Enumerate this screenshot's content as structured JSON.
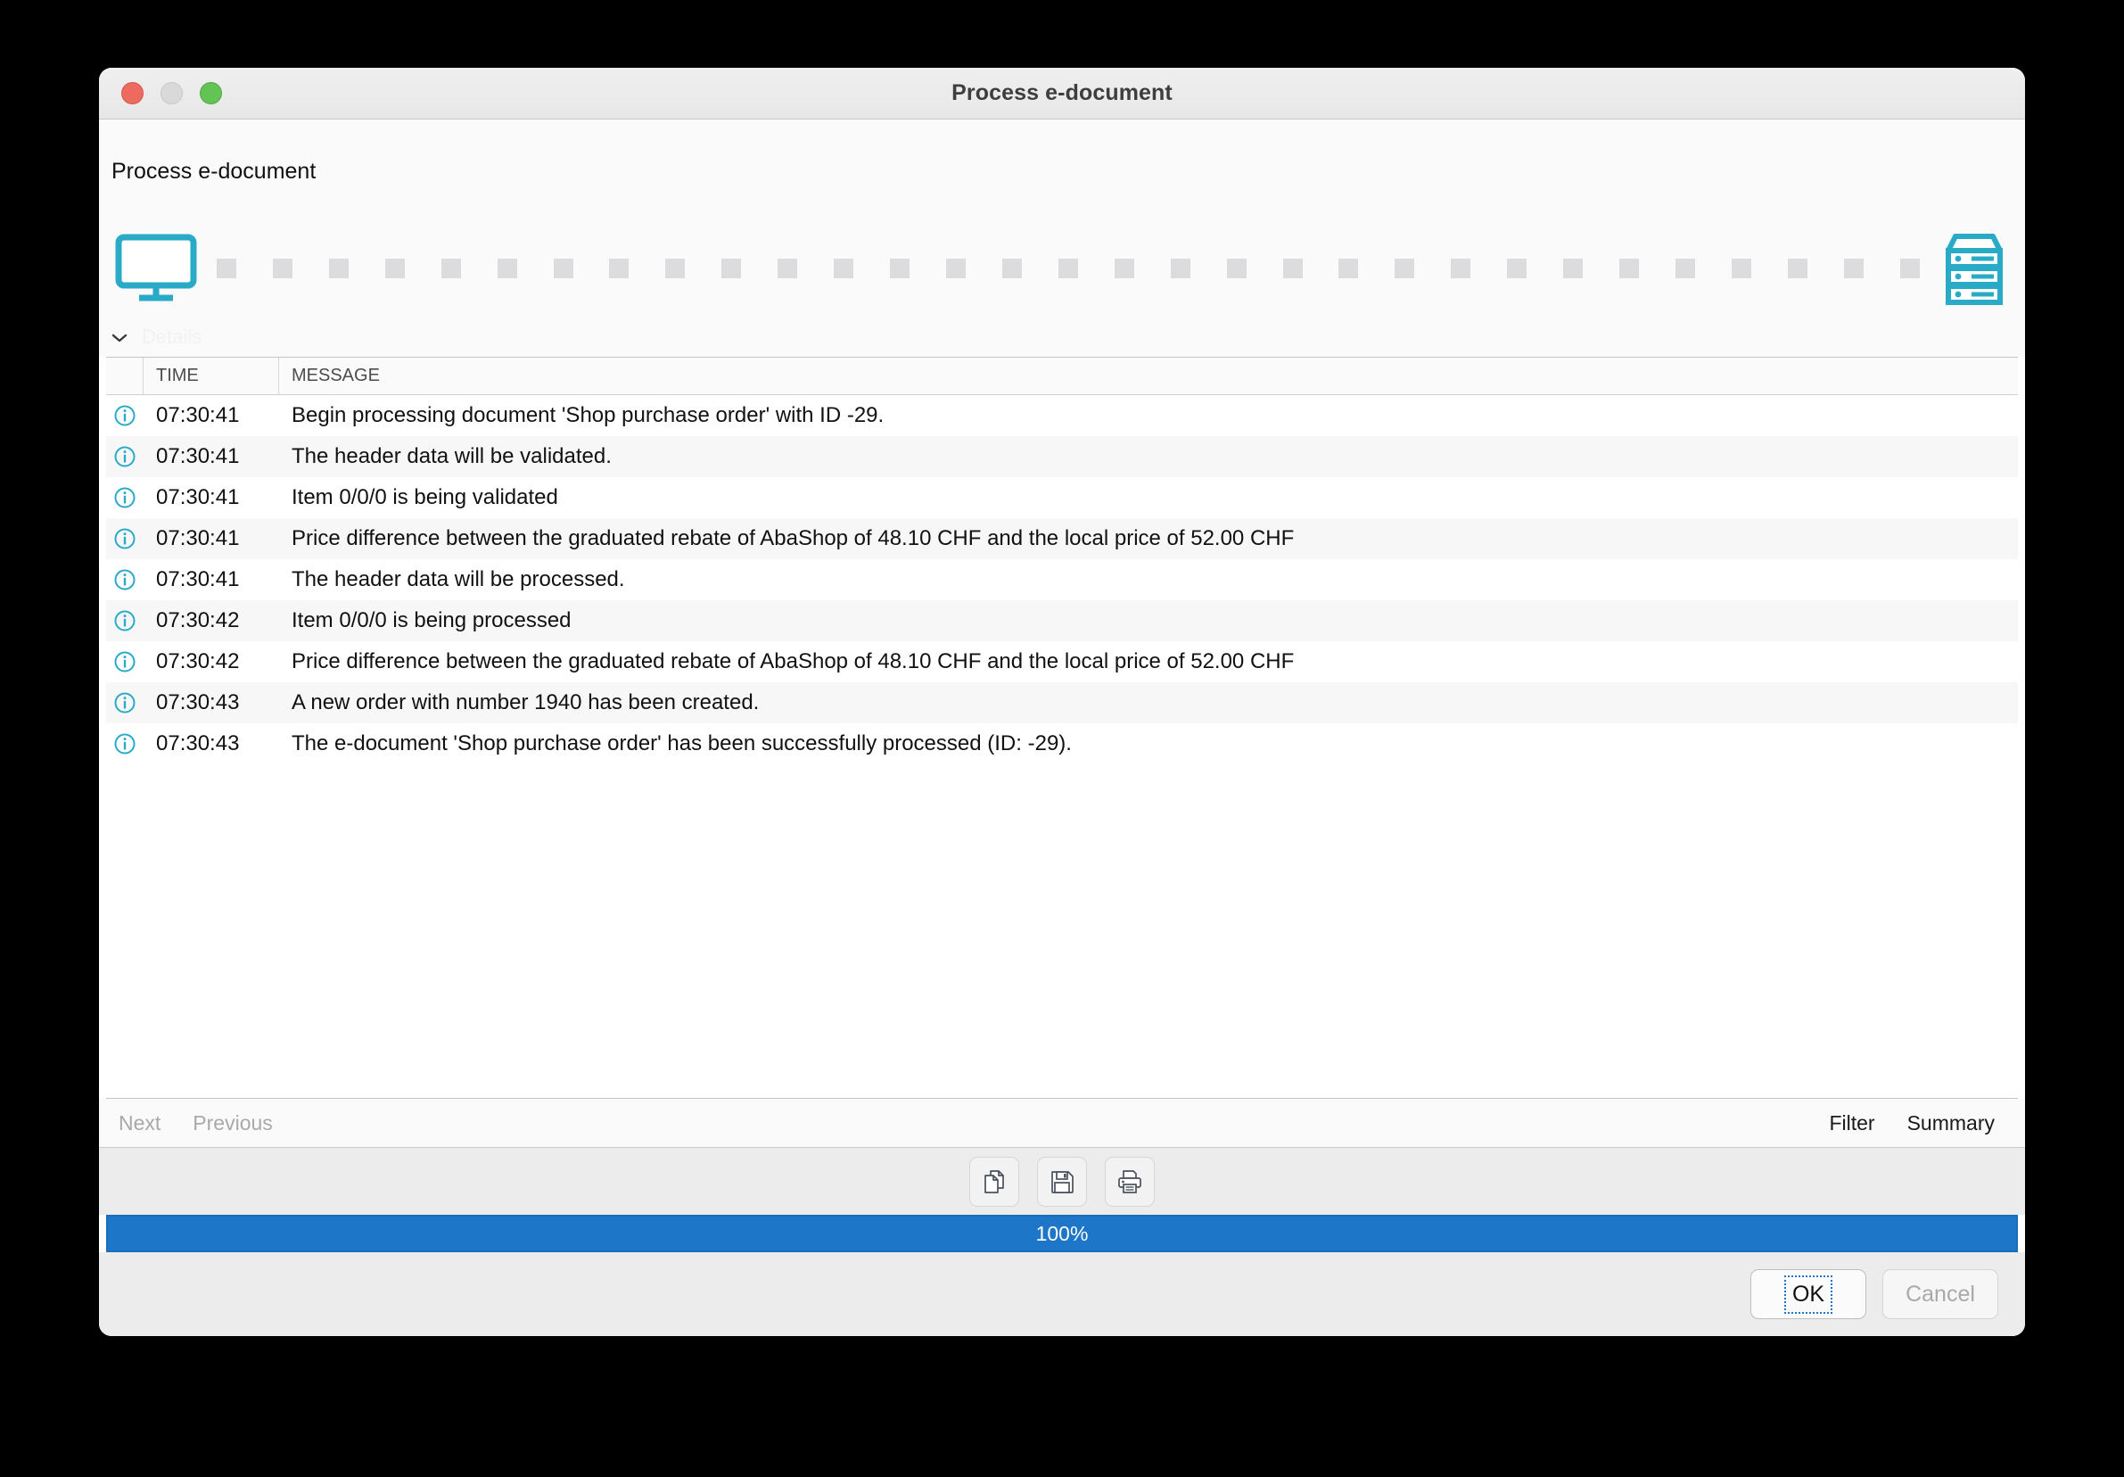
{
  "window": {
    "title": "Process e-document",
    "traffic_lights": [
      "close",
      "minimize",
      "maximize"
    ]
  },
  "header": {
    "page_title": "Process e-document"
  },
  "transfer": {
    "source_icon": "monitor-icon",
    "target_icon": "server-icon",
    "dot_count": 31,
    "dot_color": "#dcdcdf",
    "accent_color": "#29abc8"
  },
  "details": {
    "label": "Details",
    "expanded": true,
    "chevron_icon": "chevron-down-icon"
  },
  "table": {
    "columns": [
      "",
      "TIME",
      "MESSAGE"
    ],
    "rows": [
      {
        "icon": "info-icon",
        "time": "07:30:41",
        "message": "Begin processing document 'Shop purchase order' with ID -29."
      },
      {
        "icon": "info-icon",
        "time": "07:30:41",
        "message": "The header data will be validated."
      },
      {
        "icon": "info-icon",
        "time": "07:30:41",
        "message": "Item 0/0/0 is being validated"
      },
      {
        "icon": "info-icon",
        "time": "07:30:41",
        "message": "Price difference between the graduated rebate of AbaShop of 48.10 CHF and the local price of 52.00 CHF"
      },
      {
        "icon": "info-icon",
        "time": "07:30:41",
        "message": "The header data will be processed."
      },
      {
        "icon": "info-icon",
        "time": "07:30:42",
        "message": "Item 0/0/0 is being processed"
      },
      {
        "icon": "info-icon",
        "time": "07:30:42",
        "message": "Price difference between the graduated rebate of AbaShop of 48.10 CHF and the local price of 52.00 CHF"
      },
      {
        "icon": "info-icon",
        "time": "07:30:43",
        "message": "A new order with number 1940 has been created."
      },
      {
        "icon": "info-icon",
        "time": "07:30:43",
        "message": "The e-document 'Shop purchase order' has been successfully processed (ID: -29)."
      }
    ]
  },
  "navbar": {
    "next": "Next",
    "previous": "Previous",
    "filter": "Filter",
    "summary": "Summary"
  },
  "toolbar": {
    "copy_icon": "copy-icon",
    "save_icon": "save-icon",
    "print_icon": "print-icon"
  },
  "progress": {
    "label": "100%",
    "percent": 100,
    "fill_color": "#1e76c8"
  },
  "footer": {
    "ok": "OK",
    "cancel": "Cancel"
  }
}
